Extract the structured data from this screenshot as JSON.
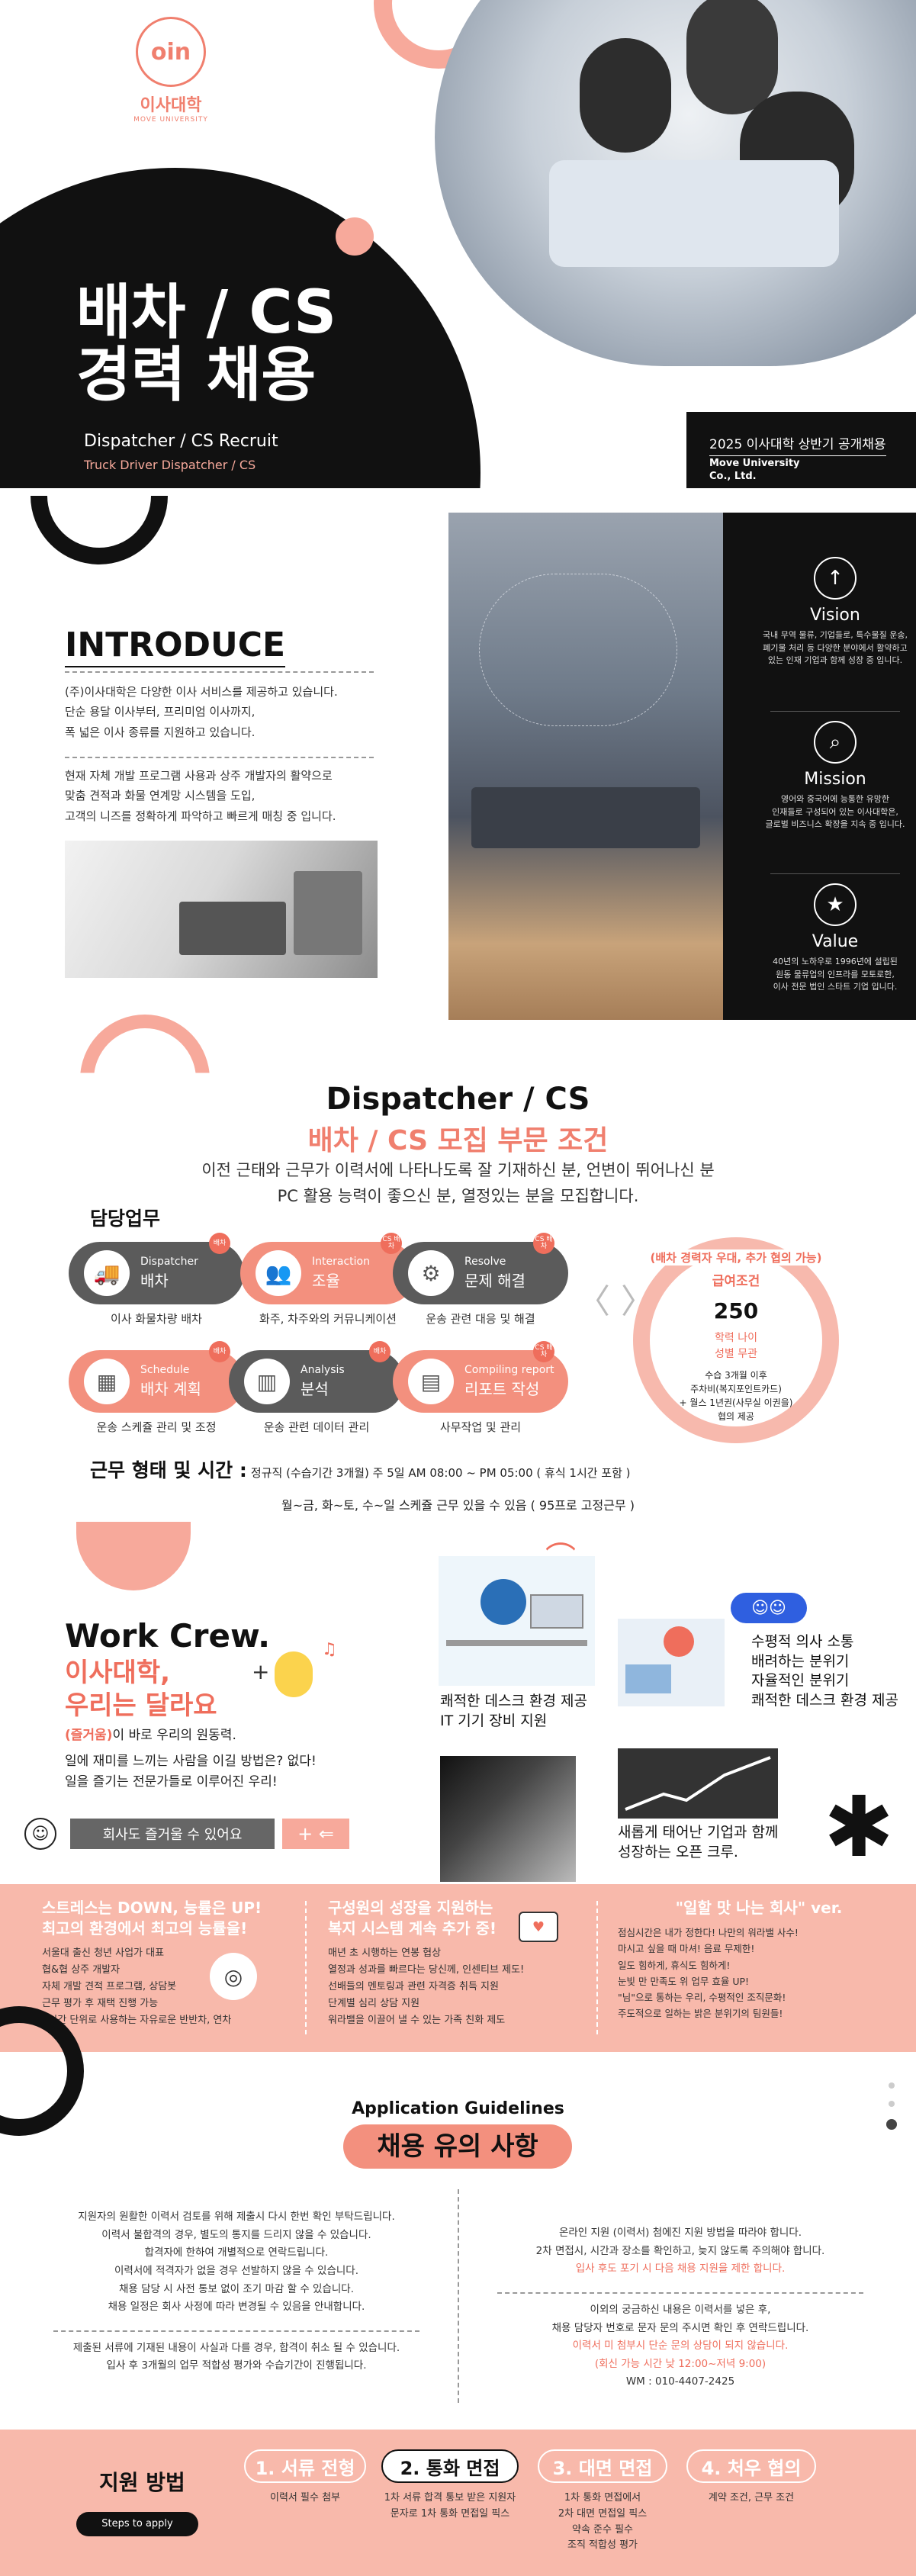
{
  "hero": {
    "logo_text": "이사대학",
    "logo_sub": "MOVE UNIVERSITY",
    "title_line1": "배차 / CS",
    "title_line2": "경력 채용",
    "subtitle": "Dispatcher / CS Recruit",
    "subtitle2": "Truck Driver Dispatcher / CS",
    "right_title": "2025 이사대학 상반기 공개채용",
    "right_company": "Move University Co., Ltd."
  },
  "intro": {
    "heading": "INTRODUCE",
    "p1": [
      "(주)이사대학은 다양한 이사 서비스를 제공하고 있습니다.",
      "단순 용달 이사부터, 프리미엄 이사까지,",
      "폭 넓은 이사 종류를 지원하고 있습니다."
    ],
    "p2": [
      "현재 자체 개발 프로그램 사용과 상주 개발자의 활약으로",
      "맞춤 견적과 화물 연계망 시스템을 도입,",
      "고객의 니즈를 정확하게 파악하고 빠르게 매칭 중 입니다."
    ]
  },
  "values": [
    {
      "icon": "arrow-up-icon",
      "glyph": "↑",
      "title": "Vision",
      "desc": [
        "국내 무역 물류, 기업들로, 특수물질 운송,",
        "폐기물 처리 등 다양한 분야에서 활약하고",
        "있는 인재 기업과 함께 성장 중 입니다."
      ]
    },
    {
      "icon": "search-icon",
      "glyph": "⌕",
      "title": "Mission",
      "desc": [
        "영어와 중국어에 능통한 유망한",
        "인재들로 구성되어 있는 이사대학은,",
        "글로벌 비즈니스 확장을 지속 중 입니다."
      ]
    },
    {
      "icon": "star-icon",
      "glyph": "★",
      "title": "Value",
      "desc": [
        "40년의 노하우로 1996년에 설립된",
        "원동 물류업의 인프라를 모토로한,",
        "이사 전문 법인 스타트 기업 입니다."
      ]
    }
  ],
  "recruit": {
    "title_en": "Dispatcher / CS",
    "title_ko": "배차 / CS 모집 부문 조건",
    "desc": [
      "이전 근태와 근무가 이력서에 나타나도록 잘 기재하신 분, 언변이 뛰어나신 분",
      "PC 활용 능력이 좋으신 분, 열정있는 분을 모집합니다."
    ],
    "duties_label": "담당업무",
    "tasks": [
      {
        "en": "Dispatcher",
        "ko": "배차",
        "tag": "배차",
        "icon": "truck-icon",
        "glyph": "🚚",
        "caption": "이사 화물차량 배차"
      },
      {
        "en": "Interaction",
        "ko": "조율",
        "tag": "CS 배차",
        "icon": "people-icon",
        "glyph": "👥",
        "caption": "화주, 차주와의 커뮤니케이션"
      },
      {
        "en": "Resolve",
        "ko": "문제 해결",
        "tag": "CS 배차",
        "icon": "gear-head-icon",
        "glyph": "⚙",
        "caption": "운송 관련 대응 및 해결"
      },
      {
        "en": "Schedule",
        "ko": "배차 계획",
        "tag": "배차",
        "icon": "calendar-icon",
        "glyph": "▦",
        "caption": "운송 스케쥴 관리 및 조정"
      },
      {
        "en": "Analysis",
        "ko": "분석",
        "tag": "배차",
        "icon": "bar-chart-icon",
        "glyph": "▥",
        "caption": "운송 관련 데이터 관리"
      },
      {
        "en": "Compiling report",
        "ko": "리포트 작성",
        "tag": "CS 배차",
        "icon": "document-icon",
        "glyph": "▤",
        "caption": "사무작업 및 관리"
      }
    ],
    "circle": {
      "top": "(배차 경력자 우대, 추가 협의 가능)",
      "label": "급여조건",
      "amount": "250",
      "line1": "학력 나이",
      "line2": "성별 무관",
      "line3": "수습 3개월 이후",
      "line4": "주차비(복지포인트카드)",
      "line5": "+ 월스 1년권(사무실 이권을)",
      "line6": "협의 제공"
    },
    "hours_label": "근무 형태 및 시간 :",
    "hours_value": "정규직 (수습기간 3개월) 주 5일 AM 08:00 ~ PM 05:00 ( 휴식 1시간 포함 )",
    "hours_note": "월~금, 화~토, 수~일 스케쥴 근무 있을 수 있음 ( 95프로 고정근무 )"
  },
  "crew": {
    "title": "Work Crew.",
    "pink1": "이사대학,",
    "pink2": "우리는 달라요",
    "line1_em": "(즐거움)",
    "line1": "이 바로 우리의 원동력.",
    "line2": "일에 재미를 느끼는 사람을 이길 방법은? 없다!",
    "line3": "일을 즐기는 전문가들로 이루어진 우리!",
    "badge": "회사도 즐거울 수 있어요",
    "f1": [
      "쾌적한 데스크 환경 제공",
      "IT 기기 장비 지원"
    ],
    "f2": [
      "수평적 의사 소통",
      "배려하는 분위기",
      "자율적인 분위기",
      "쾌적한 데스크 환경 제공"
    ],
    "f3": [
      "새롭게 태어난 기업과 함께",
      "성장하는 오픈 크루."
    ]
  },
  "band": {
    "c1_title": [
      "스트레스는 DOWN, 능률은 UP!",
      "최고의 환경에서 최고의 능률을!"
    ],
    "c1_items": [
      "서울대 출신 청년 사업가 대표",
      "협&협 상주 개발자",
      "자체 개발 견적 프로그램, 상담봇",
      "근무 평가 후 재택 진행 가능",
      "2시간 단위로 사용하는 자유로운 반반차, 연차"
    ],
    "c2_title": [
      "구성원의 성장을 지원하는",
      "복지 시스템 계속 추가 중!"
    ],
    "c2_items": [
      "매년 초 시행하는 연봉 협상",
      "열정과 성과를 빠르다는 당신께, 인센티브 제도!",
      "선배들의 멘토링과 관련 자격증 취득 지원",
      "단계별 심리 상담 지원",
      "워라밸을 이끌어 낼 수 있는 가족 친화 제도"
    ],
    "c3_title": "\"일할 맛 나는 회사\" ver.",
    "c3_items": [
      "점심시간은 내가 정한다! 나만의 워라밸 사수!",
      "마시고 싶을 때 마셔! 음료 무제한!",
      "일도 힘하게, 휴식도 힘하게!",
      "눈빛 만 만족도 위 업무 효율 UP!",
      "\"님\"으로 통하는 우리, 수평적인 조직문화!",
      "주도적으로 일하는 밝은 분위기의 팀원들!"
    ]
  },
  "guide": {
    "title_en": "Application Guidelines",
    "title_ko": "채용 유의 사항",
    "left": [
      "지원자의 원활한 이력서 검토를 위해 제출시 다시 한번 확인 부탁드립니다.",
      "이력서 불합격의 경우, 별도의 통지를 드리지 않을 수 있습니다.",
      "합격자에 한하여 개별적으로 연락드립니다.",
      "이력서에 적격자가 없을 경우 선발하지 않을 수 있습니다.",
      "채용 담당 시 사전 통보 없이 조기 마감 할 수 있습니다.",
      "채용 일정은 회사 사정에 따라 변경될 수 있음을 안내합니다."
    ],
    "left2": [
      "제출된 서류에 기재된 내용이 사실과 다를 경우, 합격이 취소 될 수 있습니다.",
      "입사 후 3개월의 업무 적합성 평가와 수습기간이 진행됩니다."
    ],
    "right": [
      "온라인 지원 (이력서) 첨에진 지원 방법을 따라야 합니다.",
      "2차 면접시, 시간과 장소를 확인하고, 늦지 않도록 주의해야 합니다.",
      "입사 후도 포기 시 다음 채용 지원을 제한 합니다."
    ],
    "right2": [
      "이외의 궁금하신 내용은 이력서를 넣은 후,",
      "채용 담당자 번호로 문자 문의 주시면 확인 후 연락드립니다.",
      "이력서 미 첨부시 단순 문의 상담이 되지 않습니다.",
      "(회신 가능 시간 낮 12:00~저녁 9:00)",
      "WM : 010-4407-2425"
    ]
  },
  "apply": {
    "label": "지원 방법",
    "button": "Steps to apply",
    "steps": [
      {
        "title": "1. 서류 전형",
        "sub": [
          "이력서 필수 첨부"
        ]
      },
      {
        "title": "2. 통화 면접",
        "sub": [
          "1차 서류 합격 통보 받은 지원자",
          "문자로 1차 통화 면접일 픽스"
        ]
      },
      {
        "title": "3. 대면 면접",
        "sub": [
          "1차 통화 면접에서",
          "2차 대면 면접일 픽스",
          "약속 준수 필수",
          "조직 적합성 평가"
        ]
      },
      {
        "title": "4. 처우 협의",
        "sub": [
          "계약 조건, 근무 조건"
        ]
      }
    ]
  }
}
